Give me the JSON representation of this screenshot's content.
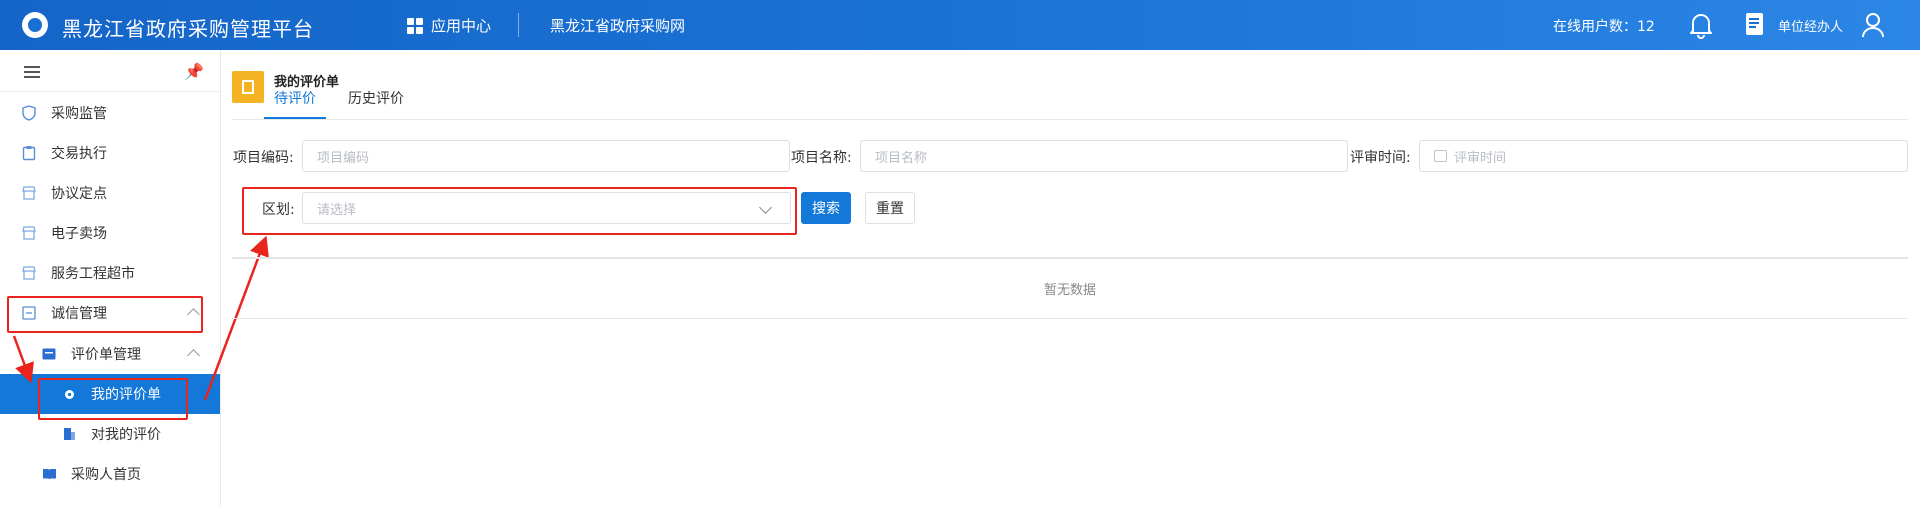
{
  "header": {
    "title": "黑龙江省政府采购管理平台",
    "app_center": "应用中心",
    "portal": "黑龙江省政府采购网",
    "online_users": "在线用户数：12",
    "role": "单位经办人"
  },
  "sidebar": {
    "items": [
      {
        "label": "采购监管",
        "icon": "shield-icon"
      },
      {
        "label": "交易执行",
        "icon": "clipboard-icon"
      },
      {
        "label": "协议定点",
        "icon": "store-icon"
      },
      {
        "label": "电子卖场",
        "icon": "store-icon"
      },
      {
        "label": "服务工程超市",
        "icon": "store-icon"
      },
      {
        "label": "诚信管理",
        "icon": "list-icon"
      },
      {
        "label": "评价单管理",
        "icon": "card-icon"
      },
      {
        "label": "我的评价单",
        "icon": "gear-icon"
      },
      {
        "label": "对我的评价",
        "icon": "building-icon"
      },
      {
        "label": "采购人首页",
        "icon": "book-icon"
      }
    ]
  },
  "page": {
    "title": "我的评价单",
    "tabs": [
      "待评价",
      "历史评价"
    ]
  },
  "filters": {
    "project_code_label": "项目编码:",
    "project_code_placeholder": "项目编码",
    "project_name_label": "项目名称:",
    "project_name_placeholder": "项目名称",
    "review_time_label": "评审时间:",
    "review_time_placeholder": "评审时间",
    "region_label": "区划:",
    "region_placeholder": "请选择",
    "search": "搜索",
    "reset": "重置"
  },
  "table": {
    "empty_text": "暂无数据"
  },
  "colors": {
    "header_blue": "#1a6fd2",
    "active_blue": "#1378d8",
    "highlight_red": "#e8241c",
    "title_icon_yellow": "#f3b322"
  }
}
